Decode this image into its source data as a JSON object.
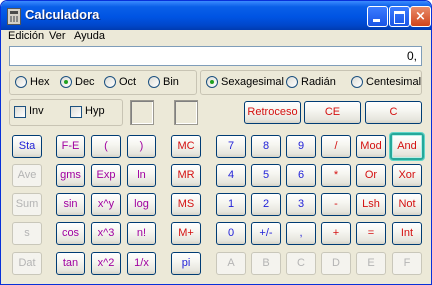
{
  "window": {
    "title": "Calculadora",
    "close_glyph": "×"
  },
  "menu": {
    "items": [
      "Edición",
      "Ver",
      "Ayuda"
    ]
  },
  "display": {
    "value": "0,"
  },
  "base": {
    "options": [
      "Hex",
      "Dec",
      "Oct",
      "Bin"
    ],
    "selected": "Dec"
  },
  "angle": {
    "options": [
      "Sexagesimal",
      "Radián",
      "Centesimal"
    ],
    "selected": "Sexagesimal"
  },
  "checks": {
    "inv": "Inv",
    "hyp": "Hyp"
  },
  "controls": {
    "backspace": "Retroceso",
    "ce": "CE",
    "c": "C"
  },
  "stat": [
    "Sta",
    "Ave",
    "Sum",
    "s",
    "Dat"
  ],
  "sci": [
    [
      "F-E",
      "(",
      ")"
    ],
    [
      "gms",
      "Exp",
      "ln"
    ],
    [
      "sin",
      "x^y",
      "log"
    ],
    [
      "cos",
      "x^3",
      "n!"
    ],
    [
      "tan",
      "x^2",
      "1/x"
    ]
  ],
  "memory": [
    "MC",
    "MR",
    "MS",
    "M+",
    "pi"
  ],
  "keypad": [
    [
      "7",
      "8",
      "9",
      "/",
      "Mod",
      "And"
    ],
    [
      "4",
      "5",
      "6",
      "*",
      "Or",
      "Xor"
    ],
    [
      "1",
      "2",
      "3",
      "-",
      "Lsh",
      "Not"
    ],
    [
      "0",
      "+/-",
      ",",
      "+",
      "=",
      "Int"
    ],
    [
      "A",
      "B",
      "C",
      "D",
      "E",
      "F"
    ]
  ],
  "colors": {
    "blue_text": "#1f1fd8",
    "red_text": "#d41010",
    "purple_text": "#a000a0",
    "disabled_text": "#b4b4b4",
    "titlebar": "#0054e3"
  }
}
